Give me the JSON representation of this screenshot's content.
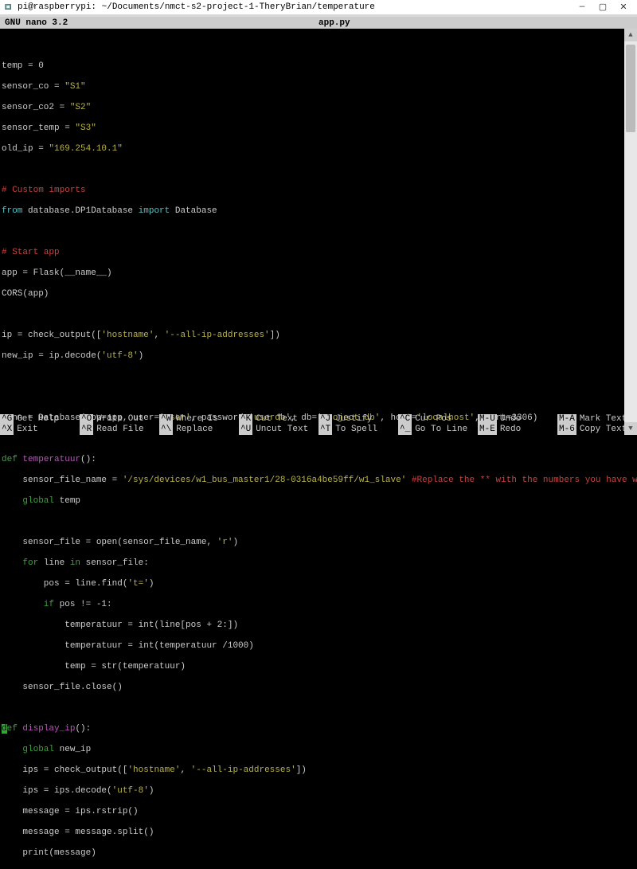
{
  "window": {
    "title": "pi@raspberrypi: ~/Documents/nmct-s2-project-1-TheryBrian/temperature"
  },
  "nano": {
    "version": "GNU nano 3.2",
    "filename": "app.py"
  },
  "code": {
    "l01": "temp = 0",
    "l02a": "sensor_co = ",
    "l02b": "\"S1\"",
    "l03a": "sensor_co2 = ",
    "l03b": "\"S2\"",
    "l04a": "sensor_temp = ",
    "l04b": "\"S3\"",
    "l05a": "old_ip = ",
    "l05b": "\"169.254.10.1\"",
    "l06": "# Custom imports",
    "l07a": "from",
    "l07b": " database.DP1Database ",
    "l07c": "import",
    "l07d": " Database",
    "l08": "# Start app",
    "l09": "app = Flask(__name__)",
    "l10": "CORS(app)",
    "l11a": "ip = check_output([",
    "l11b": "'hostname'",
    "l11c": ", ",
    "l11d": "'--all-ip-addresses'",
    "l11e": "])",
    "l12a": "new_ip = ip.decode(",
    "l12b": "'utf-8'",
    "l12c": ")",
    "l13a": "conn = Database(app=app, user=",
    "l13b": "'user'",
    "l13c": ", password=",
    "l13d": "'userdb'",
    "l13e": ", db=",
    "l13f": "'project_db'",
    "l13g": ", host=",
    "l13h": "'localhost'",
    "l13i": ", port=3306)",
    "l14a": "def",
    "l14b": " temperatuur",
    "l14c": "():",
    "l15a": "    sensor_file_name = ",
    "l15b": "'/sys/devices/w1_bus_master1/28-0316a4be59ff/w1_slave'",
    "l15c": " #Replace the ** with the numbers you have writen from",
    "l15d": "$",
    "l16a": "    global",
    "l16b": " temp",
    "l17a": "    sensor_file = open(sensor_file_name, ",
    "l17b": "'r'",
    "l17c": ")",
    "l18a": "    for",
    "l18b": " line ",
    "l18c": "in",
    "l18d": " sensor_file:",
    "l19a": "        pos = line.find(",
    "l19b": "'t='",
    "l19c": ")",
    "l20a": "        if",
    "l20b": " pos != -1:",
    "l21": "            temperatuur = int(line[pos + 2:])",
    "l22": "            temperatuur = int(temperatuur /1000)",
    "l23": "            temp = str(temperatuur)",
    "l24": "    sensor_file.close()",
    "l25a": "d",
    "l25b": "ef",
    "l25c": " display_ip",
    "l25d": "():",
    "l26a": "    global",
    "l26b": " new_ip",
    "l27a": "    ips = check_output([",
    "l27b": "'hostname'",
    "l27c": ", ",
    "l27d": "'--all-ip-addresses'",
    "l27e": "])",
    "l28a": "    ips = ips.decode(",
    "l28b": "'utf-8'",
    "l28c": ")",
    "l29": "    message = ips.rstrip()",
    "l30": "    message = message.split()",
    "l31": "    print(message)"
  },
  "shortcuts": {
    "r1": [
      {
        "key": "^G",
        "label": "Get Help"
      },
      {
        "key": "^O",
        "label": "Write Out"
      },
      {
        "key": "^W",
        "label": "Where Is"
      },
      {
        "key": "^K",
        "label": "Cut Text"
      },
      {
        "key": "^J",
        "label": "Justify"
      },
      {
        "key": "^C",
        "label": "Cur Pos"
      },
      {
        "key": "M-U",
        "label": "Undo"
      },
      {
        "key": "M-A",
        "label": "Mark Text"
      }
    ],
    "r2": [
      {
        "key": "^X",
        "label": "Exit"
      },
      {
        "key": "^R",
        "label": "Read File"
      },
      {
        "key": "^\\",
        "label": "Replace"
      },
      {
        "key": "^U",
        "label": "Uncut Text"
      },
      {
        "key": "^T",
        "label": "To Spell"
      },
      {
        "key": "^_",
        "label": "Go To Line"
      },
      {
        "key": "M-E",
        "label": "Redo"
      },
      {
        "key": "M-6",
        "label": "Copy Text"
      }
    ]
  }
}
